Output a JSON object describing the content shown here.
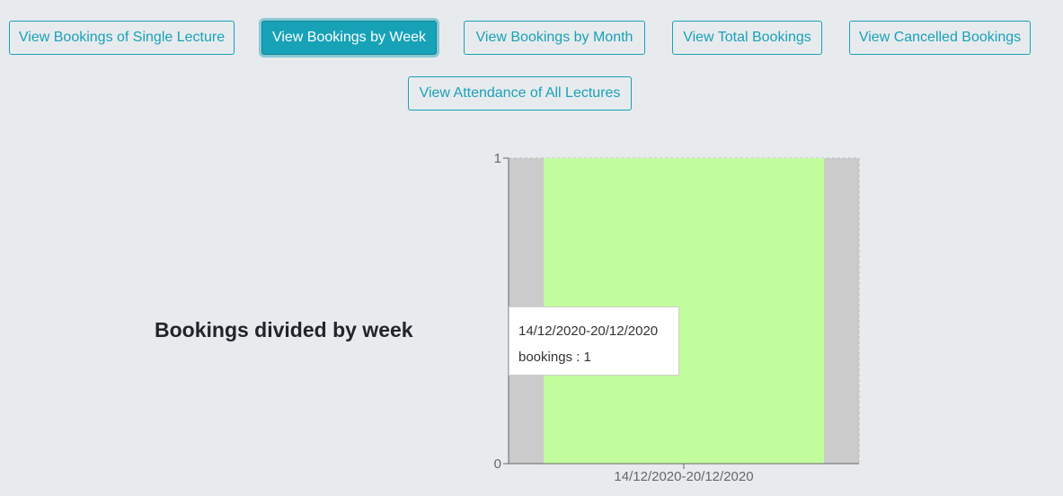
{
  "toolbar": {
    "buttons": [
      {
        "label": "View Bookings of Single Lecture",
        "active": false
      },
      {
        "label": "View Bookings by Week",
        "active": true
      },
      {
        "label": "View Bookings by Month",
        "active": false
      },
      {
        "label": "View Total Bookings",
        "active": false
      },
      {
        "label": "View Cancelled Bookings",
        "active": false
      },
      {
        "label": "View Attendance of All Lectures",
        "active": false
      }
    ]
  },
  "colors": {
    "accent": "#17a2b8",
    "bar": "#c2fd9d",
    "cursor": "#cbcbcb",
    "background": "#e8ebee"
  },
  "section": {
    "title": "Bookings divided by week"
  },
  "tooltip": {
    "label": "14/12/2020-20/12/2020",
    "entry": "bookings : 1"
  },
  "chart_data": {
    "type": "bar",
    "categories": [
      "14/12/2020-20/12/2020"
    ],
    "series": [
      {
        "name": "bookings",
        "values": [
          1
        ]
      }
    ],
    "ylim": [
      0,
      1
    ],
    "yticks": [
      "0",
      "1"
    ],
    "grid": true,
    "active_category": 0
  }
}
